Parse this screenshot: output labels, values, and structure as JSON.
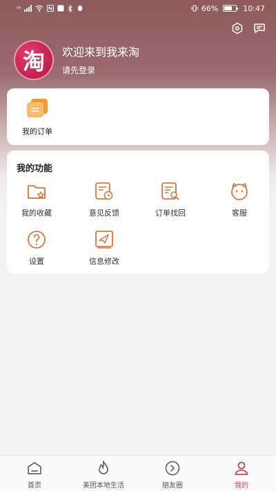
{
  "status_bar": {
    "left_indicators": "⁵⁶",
    "battery": "66%",
    "time": "10:47"
  },
  "header": {
    "avatar_text": "淘",
    "welcome": "欢迎来到我来淘",
    "login_prompt": "请先登录"
  },
  "orders": {
    "label": "我的订单"
  },
  "functions": {
    "title": "我的功能",
    "items": [
      {
        "label": "我的收藏",
        "icon": "folder-star-icon"
      },
      {
        "label": "意见反馈",
        "icon": "feedback-clock-icon"
      },
      {
        "label": "订单找回",
        "icon": "order-search-icon"
      },
      {
        "label": "客服",
        "icon": "customer-service-icon"
      },
      {
        "label": "设置",
        "icon": "help-circle-icon"
      },
      {
        "label": "信息修改",
        "icon": "send-edit-icon"
      }
    ]
  },
  "tabbar": {
    "items": [
      {
        "label": "首页",
        "icon": "home-icon"
      },
      {
        "label": "美团本地生活",
        "icon": "flame-icon"
      },
      {
        "label": "朋友圈",
        "icon": "circle-arrow-icon"
      },
      {
        "label": "我的",
        "icon": "user-icon",
        "active": true
      }
    ]
  },
  "colors": {
    "accent": "#d9773b",
    "active_tab": "#d9404f",
    "header_bg": "#8e5a5c"
  }
}
